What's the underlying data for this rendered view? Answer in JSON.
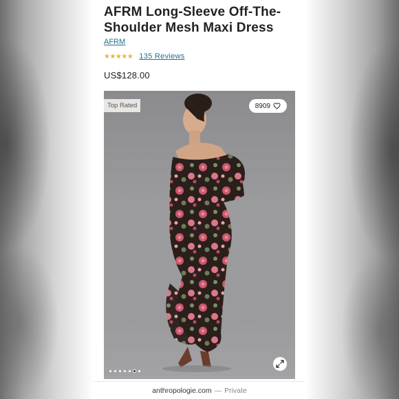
{
  "product": {
    "title": "AFRM Long-Sleeve Off-The-Shoulder Mesh Maxi Dress",
    "brand": "AFRM",
    "stars": "★★★★★",
    "rating_value": 5,
    "reviews_label": "135 Reviews",
    "price": "US$128.00"
  },
  "image": {
    "badge": "Top Rated",
    "likes": "8909",
    "slide_count": 7,
    "active_slide": 6
  },
  "footer": {
    "domain": "anthropologie.com",
    "separator": "—",
    "privacy": "Private"
  },
  "colors": {
    "link": "#1f6f8b",
    "stars": "#e8b33b",
    "badge_bg": "#e8e6e3"
  }
}
